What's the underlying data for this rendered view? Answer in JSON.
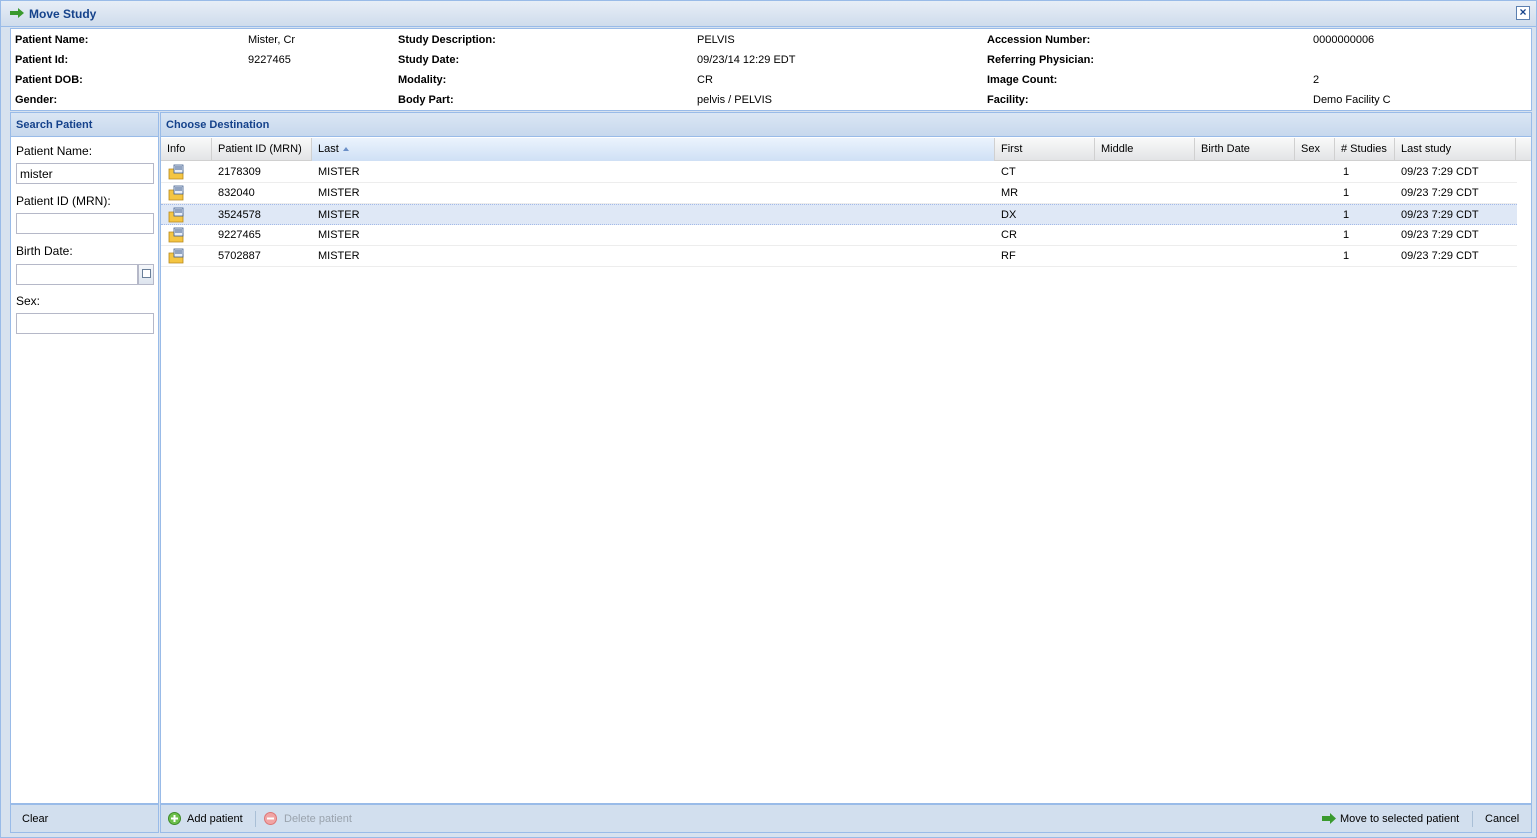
{
  "window": {
    "title": "Move Study",
    "close_label": "×"
  },
  "study_info": {
    "patient_name": {
      "label": "Patient Name:",
      "value": "Mister, Cr"
    },
    "patient_id": {
      "label": "Patient Id:",
      "value": "9227465"
    },
    "patient_dob": {
      "label": "Patient DOB:",
      "value": ""
    },
    "gender": {
      "label": "Gender:",
      "value": ""
    },
    "study_description": {
      "label": "Study Description:",
      "value": "PELVIS"
    },
    "study_date": {
      "label": "Study Date:",
      "value": "09/23/14 12:29 EDT"
    },
    "modality": {
      "label": "Modality:",
      "value": "CR"
    },
    "body_part": {
      "label": "Body Part:",
      "value": "pelvis / PELVIS"
    },
    "accession_number": {
      "label": "Accession Number:",
      "value": "0000000006"
    },
    "referring_physician": {
      "label": "Referring Physician:",
      "value": ""
    },
    "image_count": {
      "label": "Image Count:",
      "value": "2"
    },
    "facility": {
      "label": "Facility:",
      "value": "Demo Facility C"
    }
  },
  "search": {
    "title": "Search Patient",
    "patient_name_label": "Patient Name:",
    "patient_name_value": "mister",
    "patient_id_label": "Patient ID (MRN):",
    "patient_id_value": "",
    "birth_date_label": "Birth Date:",
    "birth_date_value": "",
    "sex_label": "Sex:",
    "sex_value": "",
    "clear_label": "Clear"
  },
  "destination": {
    "title": "Choose Destination",
    "columns": [
      "Info",
      "Patient ID (MRN)",
      "Last",
      "First",
      "Middle",
      "Birth Date",
      "Sex",
      "# Studies",
      "Last study"
    ],
    "sorted_column": "Last",
    "rows": [
      {
        "patient_id": "2178309",
        "last": "MISTER",
        "first": "CT",
        "middle": "",
        "birth_date": "",
        "sex": "",
        "studies": "1",
        "last_study": "09/23 7:29 CDT"
      },
      {
        "patient_id": "832040",
        "last": "MISTER",
        "first": "MR",
        "middle": "",
        "birth_date": "",
        "sex": "",
        "studies": "1",
        "last_study": "09/23 7:29 CDT"
      },
      {
        "patient_id": "3524578",
        "last": "MISTER",
        "first": "DX",
        "middle": "",
        "birth_date": "",
        "sex": "",
        "studies": "1",
        "last_study": "09/23 7:29 CDT"
      },
      {
        "patient_id": "9227465",
        "last": "MISTER",
        "first": "CR",
        "middle": "",
        "birth_date": "",
        "sex": "",
        "studies": "1",
        "last_study": "09/23 7:29 CDT"
      },
      {
        "patient_id": "5702887",
        "last": "MISTER",
        "first": "RF",
        "middle": "",
        "birth_date": "",
        "sex": "",
        "studies": "1",
        "last_study": "09/23 7:29 CDT"
      }
    ],
    "selected_row": 2,
    "add_patient_label": "Add patient",
    "delete_patient_label": "Delete patient",
    "move_label": "Move to selected patient",
    "cancel_label": "Cancel"
  },
  "colors": {
    "accent": "#15428b",
    "border": "#99bbe8",
    "selected_row": "#dfe8f6"
  }
}
